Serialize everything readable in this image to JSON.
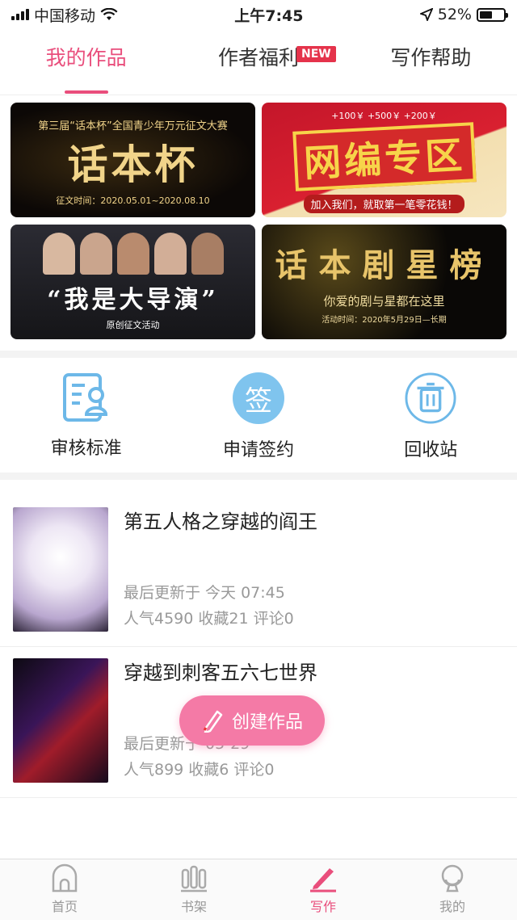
{
  "status_bar": {
    "carrier": "中国移动",
    "time": "上午7:45",
    "battery": "52%",
    "battery_level": 0.52
  },
  "tabs": [
    {
      "label": "我的作品",
      "active": true
    },
    {
      "label": "作者福利",
      "badge": "NEW"
    },
    {
      "label": "写作帮助"
    }
  ],
  "banners": [
    {
      "title": "话本杯",
      "subtitle": "第三届“话本杯”全国青少年万元征文大赛",
      "note": "征文时间：2020.05.01~2020.08.10"
    },
    {
      "title": "网编专区",
      "subtitle": "加入我们，就取第一笔零花钱！",
      "note": "+100￥ +500￥ +200￥"
    },
    {
      "title": "“我是大导演”",
      "subtitle": "原创征文活动"
    },
    {
      "title": "话本剧星榜",
      "subtitle": "你爱的剧与星都在这里",
      "note": "活动时间：2020年5月29日—长期"
    }
  ],
  "actions": [
    {
      "label": "审核标准",
      "icon": "review-standard-icon"
    },
    {
      "label": "申请签约",
      "icon": "sign-contract-icon",
      "glyph": "签"
    },
    {
      "label": "回收站",
      "icon": "trash-icon"
    }
  ],
  "works": [
    {
      "title": "第五人格之穿越的阎王",
      "updated": "最后更新于 今天 07:45",
      "stats": "人气4590 收藏21 评论0"
    },
    {
      "title": "穿越到刺客五六七世界",
      "updated": "最后更新于 05-29",
      "stats": "人气899 收藏6 评论0"
    }
  ],
  "fab": {
    "label": "创建作品"
  },
  "bottom_nav": [
    {
      "label": "首页"
    },
    {
      "label": "书架"
    },
    {
      "label": "写作",
      "active": true
    },
    {
      "label": "我的"
    }
  ],
  "colors": {
    "accent": "#e94e7c",
    "fab": "#f47aa6",
    "icon_blue": "#7fc4ee"
  }
}
